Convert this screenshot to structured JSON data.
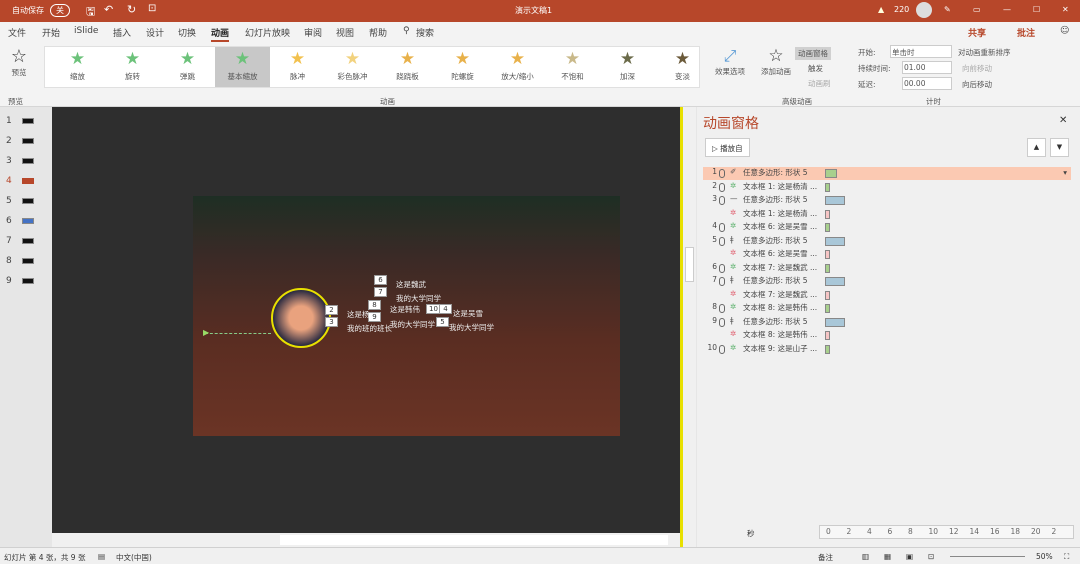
{
  "titlebar": {
    "autosave": "自动保存",
    "autosave_state": "关",
    "doc_title": "演示文稿1",
    "warning_count": "220"
  },
  "tabs": [
    "文件",
    "开始",
    "iSlide",
    "插入",
    "设计",
    "切换",
    "动画",
    "幻灯片放映",
    "审阅",
    "视图",
    "帮助",
    "搜索"
  ],
  "share": "共享",
  "comment": "批注",
  "ribbon": {
    "preview": "预览",
    "preview_group": "预览",
    "gallery": [
      "缩放",
      "旋转",
      "弹跳",
      "基本缩放",
      "脉冲",
      "彩色脉冲",
      "跷跷板",
      "陀螺旋",
      "放大/缩小",
      "不饱和",
      "加深",
      "变淡"
    ],
    "effect_options": "效果选项",
    "animation_group": "动画",
    "add_animation": "添加动画",
    "animation_pane": "动画窗格",
    "trigger": "触发",
    "painter": "动画刷",
    "advanced_group": "高级动画",
    "start_label": "开始:",
    "start_value": "单击时",
    "duration_label": "持续时间:",
    "duration_value": "01.00",
    "delay_label": "延迟:",
    "delay_value": "00.00",
    "reorder": "对动画重新排序",
    "move_earlier": "向前移动",
    "move_later": "向后移动",
    "timing_group": "计时"
  },
  "slides": [
    "1",
    "2",
    "3",
    "4",
    "5",
    "6",
    "7",
    "8",
    "9"
  ],
  "slide_content": {
    "texts": [
      "这是魏武",
      "我的大学同学",
      "这是韩伟",
      "这是杨",
      "我的班的班长",
      "我的大学同学",
      "这是吴雪",
      "我的大学同学"
    ],
    "tags": [
      "6",
      "7",
      "8",
      "9",
      "2",
      "3",
      "10",
      "4",
      "5"
    ]
  },
  "pane": {
    "title": "动画窗格",
    "play": "播放自",
    "rows": [
      {
        "n": "1",
        "icon": "✐",
        "label": "任意多边形: 形状 5",
        "color": "#a8d08d",
        "sel": true,
        "w": 12
      },
      {
        "n": "2",
        "icon": "✲",
        "label": "文本框 1: 这是杨清 ...",
        "color": "#a8d08d",
        "w": 5
      },
      {
        "n": "3",
        "icon": "—",
        "label": "任意多边形: 形状 5",
        "color": "#a9c7d8",
        "w": 20
      },
      {
        "n": "",
        "icon": "✲",
        "label": "文本框 1: 这是杨清 ...",
        "color": "#f7c6c6",
        "w": 5
      },
      {
        "n": "4",
        "icon": "✲",
        "label": "文本框 6: 这是吴雪 ...",
        "color": "#a8d08d",
        "w": 5
      },
      {
        "n": "5",
        "icon": "ǂ",
        "label": "任意多边形: 形状 5",
        "color": "#a9c7d8",
        "w": 20
      },
      {
        "n": "",
        "icon": "✲",
        "label": "文本框 6: 这是吴雪 ...",
        "color": "#f7c6c6",
        "w": 5
      },
      {
        "n": "6",
        "icon": "✲",
        "label": "文本框 7: 这是魏武 ...",
        "color": "#a8d08d",
        "w": 5
      },
      {
        "n": "7",
        "icon": "ǂ",
        "label": "任意多边形: 形状 5",
        "color": "#a9c7d8",
        "w": 20
      },
      {
        "n": "",
        "icon": "✲",
        "label": "文本框 7: 这是魏武 ...",
        "color": "#f7c6c6",
        "w": 5
      },
      {
        "n": "8",
        "icon": "✲",
        "label": "文本框 8: 这是韩伟 ...",
        "color": "#a8d08d",
        "w": 5
      },
      {
        "n": "9",
        "icon": "ǂ",
        "label": "任意多边形: 形状 5",
        "color": "#a9c7d8",
        "w": 20
      },
      {
        "n": "",
        "icon": "✲",
        "label": "文本框 8: 这是韩伟 ...",
        "color": "#f7c6c6",
        "w": 5
      },
      {
        "n": "10",
        "icon": "✲",
        "label": "文本框 9: 这是山子 ...",
        "color": "#a8d08d",
        "w": 5
      }
    ],
    "seconds": "秒",
    "ticks": [
      "0",
      "2",
      "4",
      "6",
      "8",
      "10",
      "12",
      "14",
      "16",
      "18",
      "20",
      "2"
    ]
  },
  "status": {
    "slide_info": "幻灯片 第 4 张，共 9 张",
    "language": "中文(中国)",
    "notes": "备注",
    "zoom": "50%"
  }
}
